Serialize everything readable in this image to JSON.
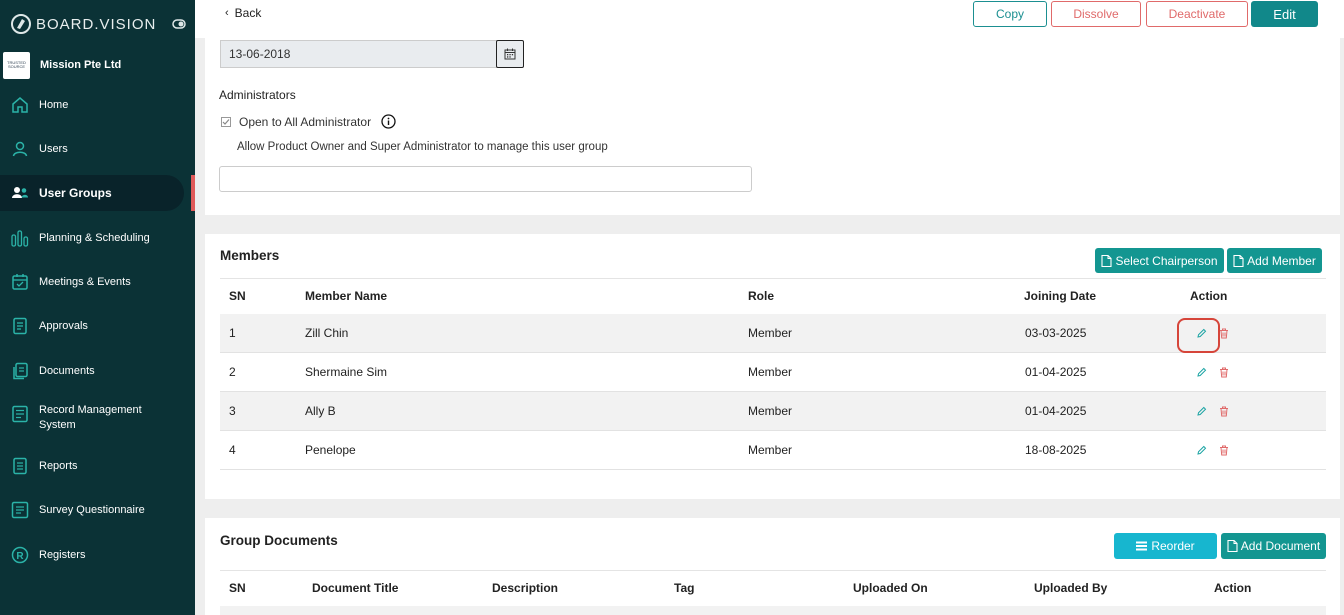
{
  "brand": {
    "name": "BOARD.VISION"
  },
  "organization": {
    "name": "Mission Pte Ltd",
    "logo_text": "TRUSTED SOURCE"
  },
  "sidebar": {
    "items": [
      {
        "label": "Home",
        "icon": "home-icon"
      },
      {
        "label": "Users",
        "icon": "user-icon"
      },
      {
        "label": "User Groups",
        "icon": "user-groups-icon",
        "active": true
      },
      {
        "label": "Planning & Scheduling",
        "icon": "chart-bars-icon"
      },
      {
        "label": "Meetings & Events",
        "icon": "calendar-icon"
      },
      {
        "label": "Approvals",
        "icon": "approvals-icon"
      },
      {
        "label": "Documents",
        "icon": "documents-icon"
      },
      {
        "label": "Record Management System",
        "label_line1": "Record Management",
        "label_line2": "System",
        "icon": "record-icon"
      },
      {
        "label": "Reports",
        "icon": "reports-icon"
      },
      {
        "label": "Survey Questionnaire",
        "icon": "survey-icon"
      },
      {
        "label": "Registers",
        "icon": "registered-icon"
      }
    ]
  },
  "toolbar": {
    "back_label": "Back",
    "copy_label": "Copy",
    "dissolve_label": "Dissolve",
    "deactivate_label": "Deactivate",
    "edit_label": "Edit"
  },
  "details": {
    "date_value": "13-06-2018",
    "administrators_label": "Administrators",
    "open_to_all_label": "Open to All Administrator",
    "allow_text": "Allow Product Owner and Super Administrator to manage this user group",
    "text_value": ""
  },
  "members": {
    "title": "Members",
    "select_chair_label": "Select Chairperson",
    "add_member_label": "Add Member",
    "columns": [
      "SN",
      "Member Name",
      "Role",
      "Joining Date",
      "Action"
    ],
    "rows": [
      {
        "sn": "1",
        "name": "Zill Chin",
        "role": "Member",
        "date": "03-03-2025"
      },
      {
        "sn": "2",
        "name": "Shermaine Sim",
        "role": "Member",
        "date": "01-04-2025"
      },
      {
        "sn": "3",
        "name": "Ally B",
        "role": "Member",
        "date": "01-04-2025"
      },
      {
        "sn": "4",
        "name": "Penelope",
        "role": "Member",
        "date": "18-08-2025"
      }
    ]
  },
  "documents": {
    "title": "Group Documents",
    "reorder_label": "Reorder",
    "add_document_label": "Add Document",
    "columns": [
      "SN",
      "Document Title",
      "Description",
      "Tag",
      "Uploaded On",
      "Uploaded By",
      "Action"
    ]
  },
  "colors": {
    "sidebar_bg": "#0b3236",
    "teal": "#139691",
    "danger": "#e06a6a",
    "reorder": "#17b6cf",
    "highlight": "#d6453a"
  }
}
